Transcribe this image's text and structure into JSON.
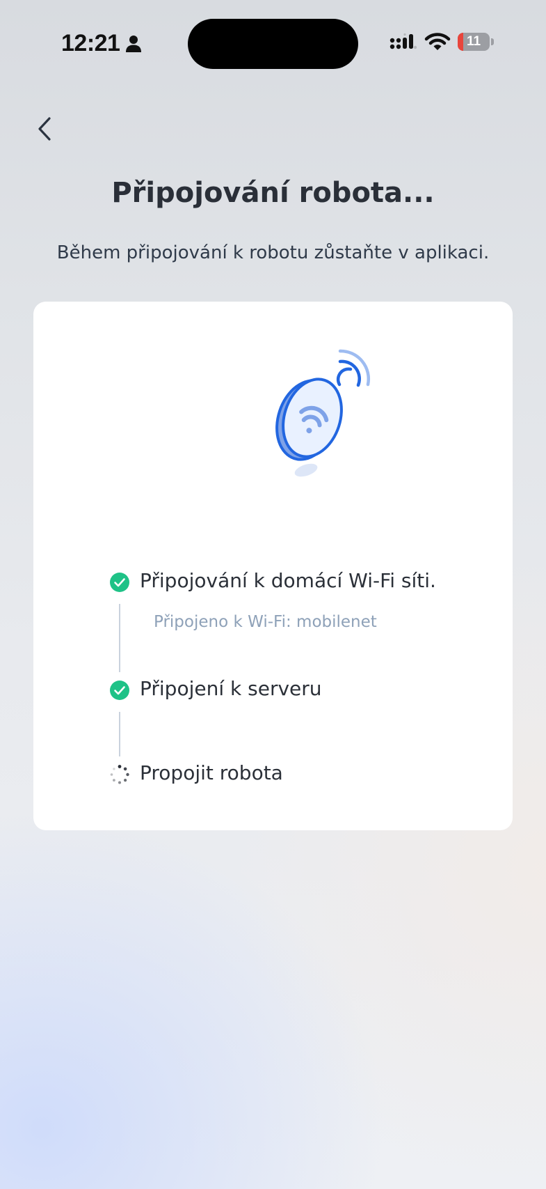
{
  "status_bar": {
    "time": "12:21",
    "battery_level": "11",
    "battery_fraction": 0.11,
    "icons": [
      "person-icon",
      "signal-icon",
      "wifi-icon",
      "battery-icon"
    ]
  },
  "header": {
    "back_icon": "chevron-left-icon",
    "title": "Připojování robota...",
    "subtitle": "Během připojování k robotu zůstaňte v aplikaci."
  },
  "card": {
    "illustration_icon": "robot-wifi-icon",
    "steps": [
      {
        "label": "Připojování k domácí Wi-Fi síti.",
        "status": "done",
        "detail": "Připojeno k Wi-Fi: mobilenet"
      },
      {
        "label": "Připojení k serveru",
        "status": "done",
        "detail": ""
      },
      {
        "label": "Propojit robota",
        "status": "in-progress",
        "detail": ""
      }
    ]
  },
  "colors": {
    "success": "#1fc287",
    "accent_blue": "#2266e0",
    "light_blue": "#e9f1ff",
    "muted_text": "#8ea1b8",
    "battery_low": "#e8453c"
  }
}
